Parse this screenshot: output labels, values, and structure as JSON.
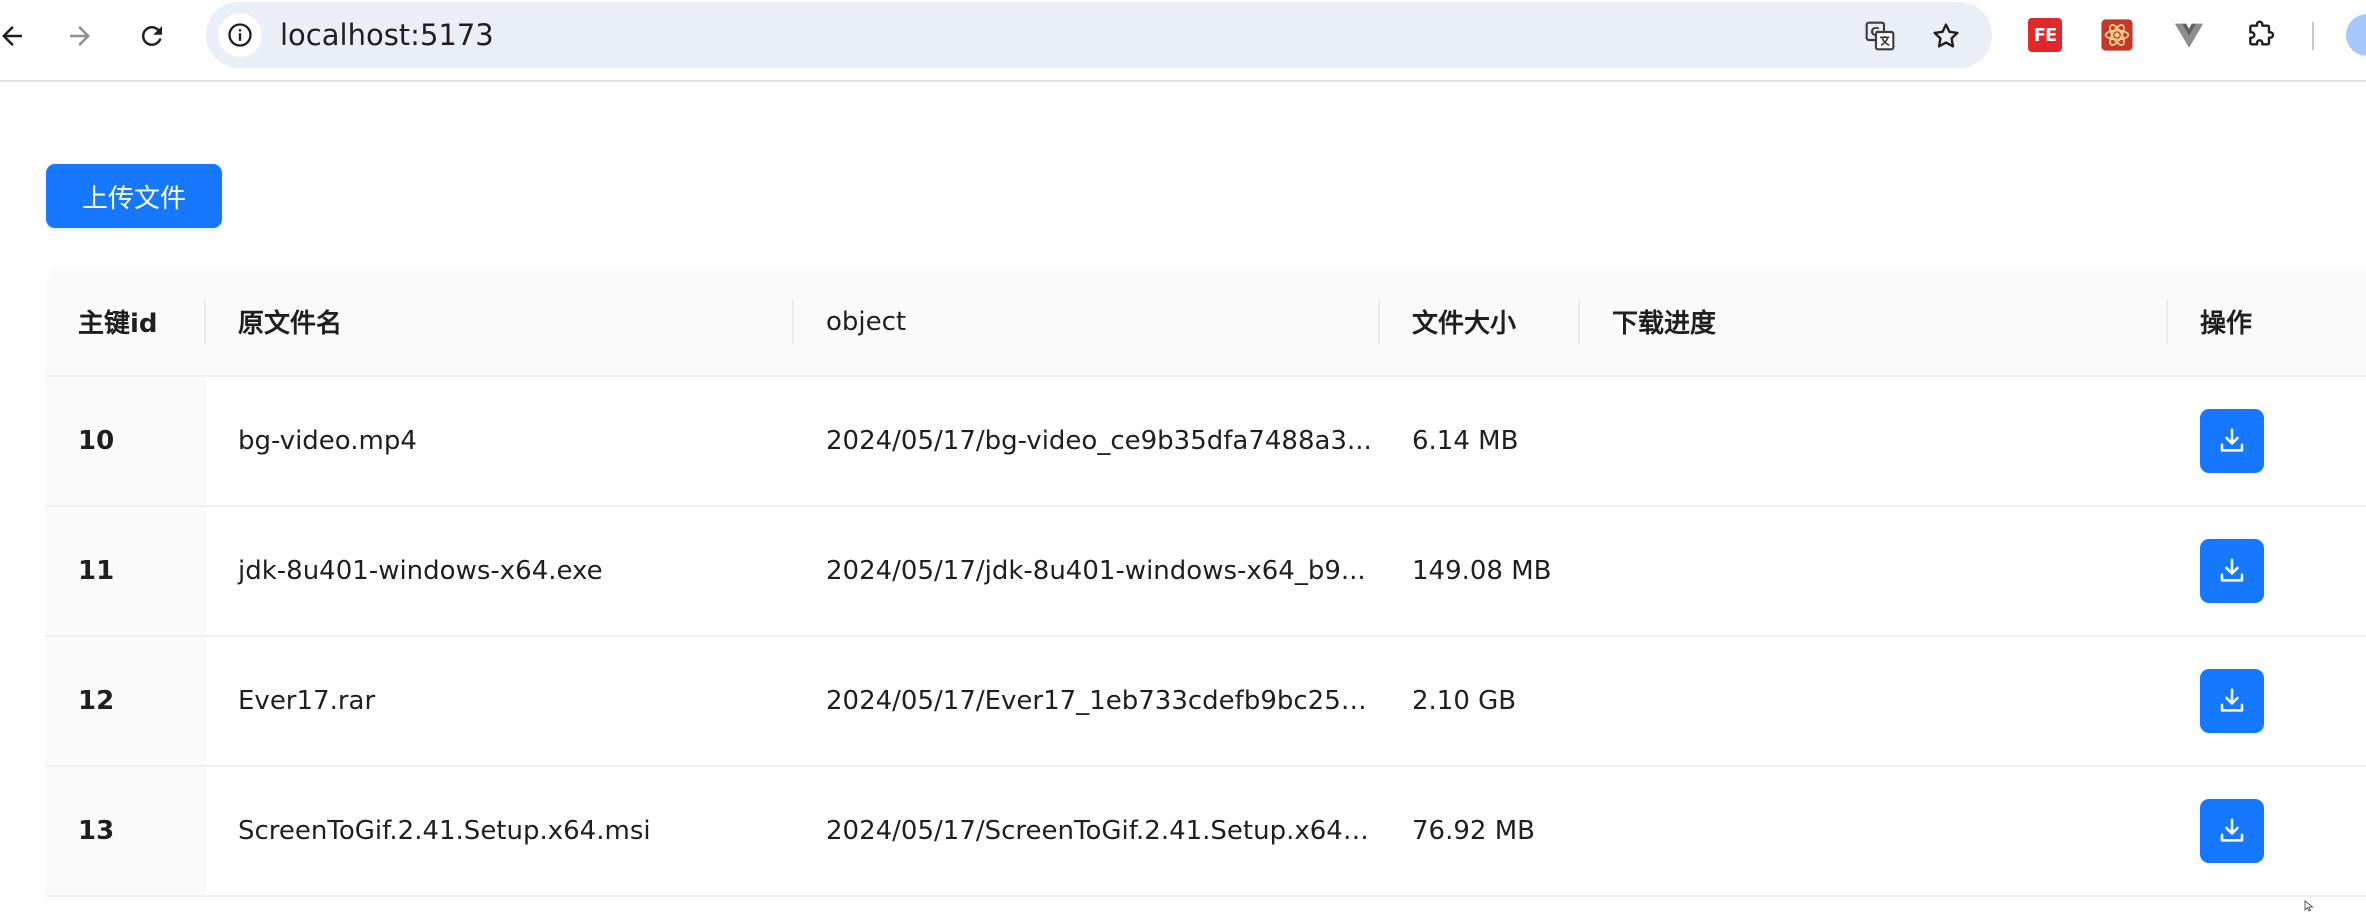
{
  "browser": {
    "url": "localhost:5173",
    "extensions": [
      "fe-helper",
      "react-devtools",
      "vue-devtools",
      "puzzle-extensions"
    ]
  },
  "toolbar": {
    "upload_label": "上传文件"
  },
  "table": {
    "columns": [
      "主键id",
      "原文件名",
      "object",
      "文件大小",
      "下载进度",
      "操作"
    ],
    "rows": [
      {
        "id": "10",
        "name": "bg-video.mp4",
        "object": "2024/05/17/bg-video_ce9b35dfa7488a3...",
        "size": "6.14 MB",
        "progress": ""
      },
      {
        "id": "11",
        "name": "jdk-8u401-windows-x64.exe",
        "object": "2024/05/17/jdk-8u401-windows-x64_b9...",
        "size": "149.08 MB",
        "progress": ""
      },
      {
        "id": "12",
        "name": "Ever17.rar",
        "object": "2024/05/17/Ever17_1eb733cdefb9bc25e...",
        "size": "2.10 GB",
        "progress": ""
      },
      {
        "id": "13",
        "name": "ScreenToGif.2.41.Setup.x64.msi",
        "object": "2024/05/17/ScreenToGif.2.41.Setup.x64_...",
        "size": "76.92 MB",
        "progress": ""
      }
    ]
  },
  "colors": {
    "primary": "#1677ff",
    "header_bg": "#fafafa"
  }
}
